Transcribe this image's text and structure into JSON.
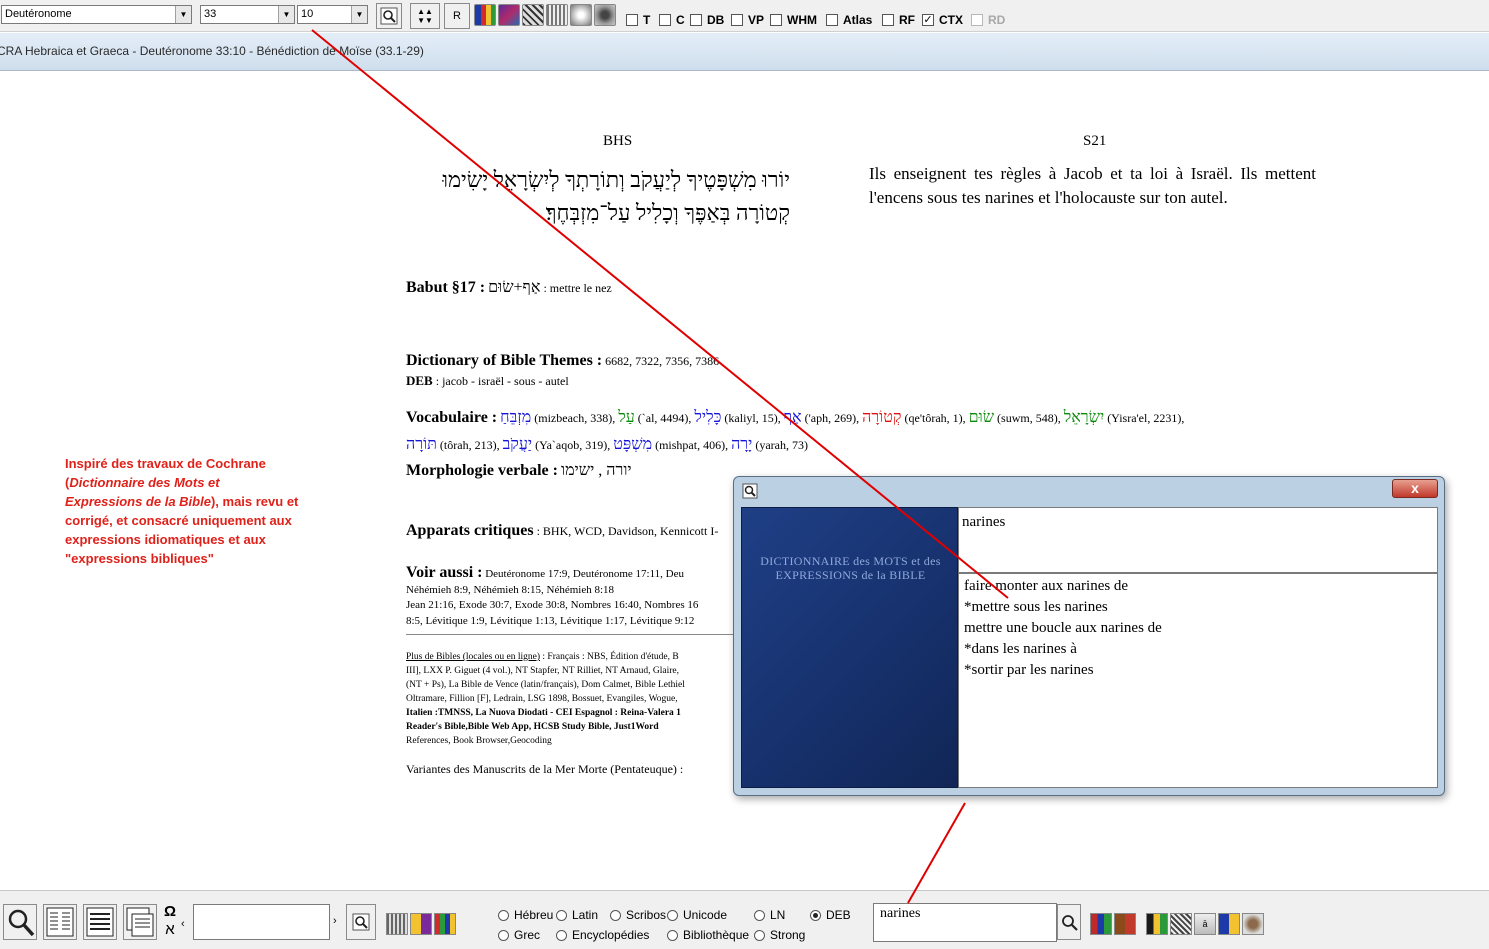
{
  "toolbar": {
    "book": "Deutéronome",
    "chapter": "33",
    "verse": "10",
    "reset_label": "R",
    "checkboxes": [
      {
        "label": "T",
        "checked": false
      },
      {
        "label": "C",
        "checked": false
      },
      {
        "label": "DB",
        "checked": false
      },
      {
        "label": "VP",
        "checked": false
      },
      {
        "label": "WHM",
        "checked": false
      },
      {
        "label": "Atlas",
        "checked": false
      },
      {
        "label": "RF",
        "checked": false
      },
      {
        "label": "CTX",
        "checked": true
      },
      {
        "label": "RD",
        "checked": false
      }
    ]
  },
  "title": "CRA Hebraica et Graeca - Deutéronome 33:10 - Bénédiction de Moïse (33.1-29)",
  "columns": {
    "left": "BHS",
    "right": "S21"
  },
  "hebrew_text": "יוֹרוּ מִשְׁפָּטֶיךָ לְיַעֲקֹב וְתוֹרָתְךָ לְיִשְׂרָאֵל יָשִׂימוּ קְטוֹרָה בְּאַפֶּךָ וְכָלִיל עַל־מִזְבְּחֶךָ׃",
  "translation": "Ils enseignent tes règles à Jacob et ta loi à Israël. Ils mettent l'encens sous tes narines et l'holocauste sur ton autel.",
  "babut": {
    "label": "Babut §17 :",
    "hebrew": "אַף+שׂוּם",
    "text": ": mettre le nez"
  },
  "themes": {
    "label": "Dictionary of Bible Themes :",
    "numbers": "6682, 7322, 7356, 7386"
  },
  "deb": {
    "label": "DEB",
    "text": ": jacob - israël - sous - autel"
  },
  "vocabulaire": {
    "label": "Vocabulaire :",
    "line1": [
      {
        "word": "מִזְבֵּחַ",
        "color": "blue",
        "info": "(mizbeach, 338), "
      },
      {
        "word": "עַל",
        "color": "green",
        "info": "(`al, 4494), "
      },
      {
        "word": "כָּלִיל",
        "color": "blue",
        "info": "(kaliyl, 15), "
      },
      {
        "word": "אַף",
        "color": "blue",
        "info": "('aph, 269), "
      },
      {
        "word": "קְטוֹרָה",
        "color": "red",
        "info": "(qe'tôrah, 1), "
      },
      {
        "word": "שׂוּם",
        "color": "green",
        "info": "(suwm, 548), "
      },
      {
        "word": "יִשְׂרָאֵל",
        "color": "green",
        "info": "(Yisra'el, 2231),"
      }
    ],
    "line2": [
      {
        "word": "תּוֹרָה",
        "color": "blue",
        "info": "(tôrah, 213), "
      },
      {
        "word": "יַעֲקֹב",
        "color": "blue",
        "info": "(Ya`aqob, 319), "
      },
      {
        "word": "מִשְׁפָּט",
        "color": "blue",
        "info": "(mishpat, 406), "
      },
      {
        "word": "יָרָה",
        "color": "blue",
        "info": "(yarah, 73)"
      }
    ]
  },
  "morphologie": {
    "label": "Morphologie verbale :",
    "text": "יורה , ישימו"
  },
  "apparats": {
    "label": "Apparats critiques",
    "text": ": BHK, WCD, Davidson, Kennicott I-"
  },
  "voir_aussi": {
    "label": "Voir aussi :",
    "line1": "Deutéronome 17:9, Deutéronome 17:11, Deu",
    "line2": "Néhémieh 8:9, Néhémieh 8:15, Néhémieh 8:18",
    "line3": "Jean 21:16, Exode 30:7, Exode 30:8, Nombres 16:40, Nombres 16",
    "line4": "8:5, Lévitique 1:9, Lévitique 1:13, Lévitique 1:17, Lévitique 9:12"
  },
  "bibles": {
    "link": "Plus de Bibles (locales ou en ligne)",
    "l1_rest": " : Français : NBS, Édition d'étude, B",
    "l2": "III], LXX P. Giguet (4 vol.), NT Stapfer, NT Rilliet, NT Arnaud, Glaire,",
    "l3": "(NT + Ps), La Bible de Vence (latin/français), Dom Calmet, Bible Lethiel",
    "l4": "Oltramare, Fillion [F], Ledrain, LSG 1898, Bossuet, Evangiles, Wogue,",
    "l5": "Italien :TMNSS, La Nuova Diodati - CEI Espagnol : Reina-Valera 1",
    "l6": "Reader's Bible,Bible Web App, HCSB Study Bible, Just1Word",
    "l7": "References, Book Browser,Geocoding"
  },
  "variantes": "Variantes des Manuscrits de la Mer Morte (Pentateuque) :",
  "note": "Inspiré des travaux de Cochrane (Dictionnaire des Mots et Expressions de la Bible), mais revu et corrigé, et consacré uniquement aux expressions idiomatiques et aux \"expressions bibliques\"",
  "note_parts": {
    "a": "Inspiré des travaux de Cochrane (",
    "b": "Dictionnaire des Mots et Expressions de la Bible",
    "c": "), mais revu et corrigé, et consacré uniquement aux expressions idiomatiques et aux \"expressions bibliques\""
  },
  "dialog": {
    "close_label": "x",
    "cover_title": "DICTIONNAIRE des MOTS et des EXPRESSIONS de la BIBLE",
    "word": "narines",
    "results": [
      "faire monter aux narines de",
      "*mettre sous les narines",
      "mettre une boucle aux narines de",
      "*dans les narines à",
      "*sortir par les narines"
    ]
  },
  "bottom": {
    "omega": "Ω",
    "aleph": "א",
    "radios": [
      {
        "label": "Hébreu",
        "checked": false
      },
      {
        "label": "Latin",
        "checked": false
      },
      {
        "label": "Scribos",
        "checked": false
      },
      {
        "label": "Unicode",
        "checked": false
      },
      {
        "label": "LN",
        "checked": false
      },
      {
        "label": "DEB",
        "checked": true
      },
      {
        "label": "Grec",
        "checked": false
      },
      {
        "label": "Encyclopédies",
        "checked": false
      },
      {
        "label": "Bibliothèque",
        "checked": false
      },
      {
        "label": "Strong",
        "checked": false
      }
    ],
    "search_value": "narines"
  },
  "colors": {
    "accent_red": "#e0211a",
    "hebrew_blue": "#1414d6",
    "hebrew_green": "#0a8a0a",
    "dialog_frame": "#bcd0e4",
    "book_cover": "#1f3f86"
  }
}
